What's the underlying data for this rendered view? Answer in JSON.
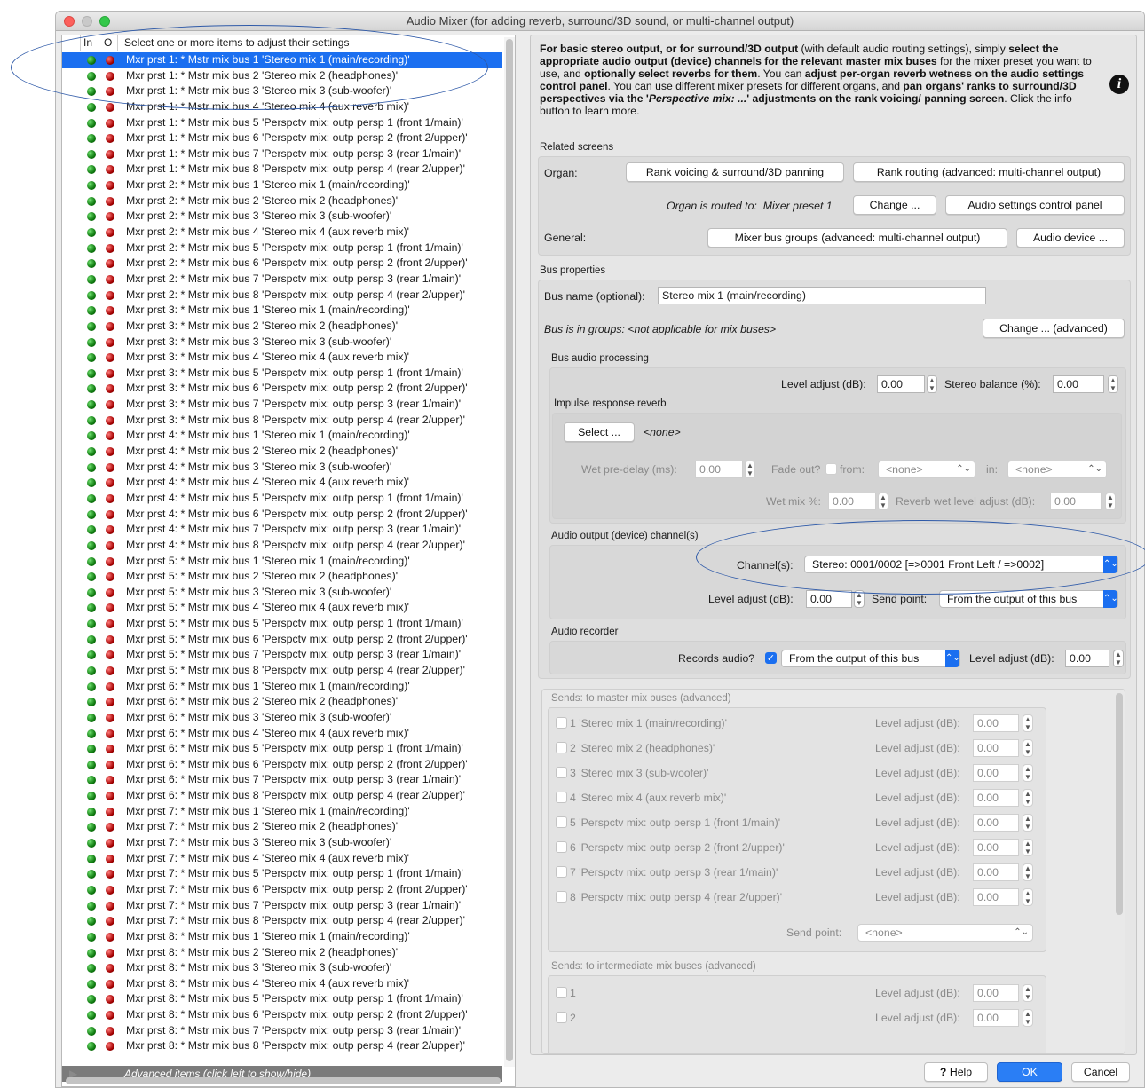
{
  "window": {
    "title": "Audio Mixer (for adding reverb, surround/3D sound, or multi-channel output)"
  },
  "list": {
    "col_in": "In",
    "col_out": "O",
    "col_desc": "Select one or more items to adjust their settings",
    "rows": [
      "Mxr prst 1: * Mstr mix bus 1 'Stereo mix 1 (main/recording)'",
      "Mxr prst 1: * Mstr mix bus 2 'Stereo mix 2 (headphones)'",
      "Mxr prst 1: * Mstr mix bus 3 'Stereo mix 3 (sub-woofer)'",
      "Mxr prst 1: * Mstr mix bus 4 'Stereo mix 4 (aux reverb mix)'",
      "Mxr prst 1: * Mstr mix bus 5 'Perspctv mix: outp persp 1 (front 1/main)'",
      "Mxr prst 1: * Mstr mix bus 6 'Perspctv mix: outp persp 2 (front 2/upper)'",
      "Mxr prst 1: * Mstr mix bus 7 'Perspctv mix: outp persp 3 (rear 1/main)'",
      "Mxr prst 1: * Mstr mix bus 8 'Perspctv mix: outp persp 4 (rear 2/upper)'",
      "Mxr prst 2: * Mstr mix bus 1 'Stereo mix 1 (main/recording)'",
      "Mxr prst 2: * Mstr mix bus 2 'Stereo mix 2 (headphones)'",
      "Mxr prst 2: * Mstr mix bus 3 'Stereo mix 3 (sub-woofer)'",
      "Mxr prst 2: * Mstr mix bus 4 'Stereo mix 4 (aux reverb mix)'",
      "Mxr prst 2: * Mstr mix bus 5 'Perspctv mix: outp persp 1 (front 1/main)'",
      "Mxr prst 2: * Mstr mix bus 6 'Perspctv mix: outp persp 2 (front 2/upper)'",
      "Mxr prst 2: * Mstr mix bus 7 'Perspctv mix: outp persp 3 (rear 1/main)'",
      "Mxr prst 2: * Mstr mix bus 8 'Perspctv mix: outp persp 4 (rear 2/upper)'",
      "Mxr prst 3: * Mstr mix bus 1 'Stereo mix 1 (main/recording)'",
      "Mxr prst 3: * Mstr mix bus 2 'Stereo mix 2 (headphones)'",
      "Mxr prst 3: * Mstr mix bus 3 'Stereo mix 3 (sub-woofer)'",
      "Mxr prst 3: * Mstr mix bus 4 'Stereo mix 4 (aux reverb mix)'",
      "Mxr prst 3: * Mstr mix bus 5 'Perspctv mix: outp persp 1 (front 1/main)'",
      "Mxr prst 3: * Mstr mix bus 6 'Perspctv mix: outp persp 2 (front 2/upper)'",
      "Mxr prst 3: * Mstr mix bus 7 'Perspctv mix: outp persp 3 (rear 1/main)'",
      "Mxr prst 3: * Mstr mix bus 8 'Perspctv mix: outp persp 4 (rear 2/upper)'",
      "Mxr prst 4: * Mstr mix bus 1 'Stereo mix 1 (main/recording)'",
      "Mxr prst 4: * Mstr mix bus 2 'Stereo mix 2 (headphones)'",
      "Mxr prst 4: * Mstr mix bus 3 'Stereo mix 3 (sub-woofer)'",
      "Mxr prst 4: * Mstr mix bus 4 'Stereo mix 4 (aux reverb mix)'",
      "Mxr prst 4: * Mstr mix bus 5 'Perspctv mix: outp persp 1 (front 1/main)'",
      "Mxr prst 4: * Mstr mix bus 6 'Perspctv mix: outp persp 2 (front 2/upper)'",
      "Mxr prst 4: * Mstr mix bus 7 'Perspctv mix: outp persp 3 (rear 1/main)'",
      "Mxr prst 4: * Mstr mix bus 8 'Perspctv mix: outp persp 4 (rear 2/upper)'",
      "Mxr prst 5: * Mstr mix bus 1 'Stereo mix 1 (main/recording)'",
      "Mxr prst 5: * Mstr mix bus 2 'Stereo mix 2 (headphones)'",
      "Mxr prst 5: * Mstr mix bus 3 'Stereo mix 3 (sub-woofer)'",
      "Mxr prst 5: * Mstr mix bus 4 'Stereo mix 4 (aux reverb mix)'",
      "Mxr prst 5: * Mstr mix bus 5 'Perspctv mix: outp persp 1 (front 1/main)'",
      "Mxr prst 5: * Mstr mix bus 6 'Perspctv mix: outp persp 2 (front 2/upper)'",
      "Mxr prst 5: * Mstr mix bus 7 'Perspctv mix: outp persp 3 (rear 1/main)'",
      "Mxr prst 5: * Mstr mix bus 8 'Perspctv mix: outp persp 4 (rear 2/upper)'",
      "Mxr prst 6: * Mstr mix bus 1 'Stereo mix 1 (main/recording)'",
      "Mxr prst 6: * Mstr mix bus 2 'Stereo mix 2 (headphones)'",
      "Mxr prst 6: * Mstr mix bus 3 'Stereo mix 3 (sub-woofer)'",
      "Mxr prst 6: * Mstr mix bus 4 'Stereo mix 4 (aux reverb mix)'",
      "Mxr prst 6: * Mstr mix bus 5 'Perspctv mix: outp persp 1 (front 1/main)'",
      "Mxr prst 6: * Mstr mix bus 6 'Perspctv mix: outp persp 2 (front 2/upper)'",
      "Mxr prst 6: * Mstr mix bus 7 'Perspctv mix: outp persp 3 (rear 1/main)'",
      "Mxr prst 6: * Mstr mix bus 8 'Perspctv mix: outp persp 4 (rear 2/upper)'",
      "Mxr prst 7: * Mstr mix bus 1 'Stereo mix 1 (main/recording)'",
      "Mxr prst 7: * Mstr mix bus 2 'Stereo mix 2 (headphones)'",
      "Mxr prst 7: * Mstr mix bus 3 'Stereo mix 3 (sub-woofer)'",
      "Mxr prst 7: * Mstr mix bus 4 'Stereo mix 4 (aux reverb mix)'",
      "Mxr prst 7: * Mstr mix bus 5 'Perspctv mix: outp persp 1 (front 1/main)'",
      "Mxr prst 7: * Mstr mix bus 6 'Perspctv mix: outp persp 2 (front 2/upper)'",
      "Mxr prst 7: * Mstr mix bus 7 'Perspctv mix: outp persp 3 (rear 1/main)'",
      "Mxr prst 7: * Mstr mix bus 8 'Perspctv mix: outp persp 4 (rear 2/upper)'",
      "Mxr prst 8: * Mstr mix bus 1 'Stereo mix 1 (main/recording)'",
      "Mxr prst 8: * Mstr mix bus 2 'Stereo mix 2 (headphones)'",
      "Mxr prst 8: * Mstr mix bus 3 'Stereo mix 3 (sub-woofer)'",
      "Mxr prst 8: * Mstr mix bus 4 'Stereo mix 4 (aux reverb mix)'",
      "Mxr prst 8: * Mstr mix bus 5 'Perspctv mix: outp persp 1 (front 1/main)'",
      "Mxr prst 8: * Mstr mix bus 6 'Perspctv mix: outp persp 2 (front 2/upper)'",
      "Mxr prst 8: * Mstr mix bus 7 'Perspctv mix: outp persp 3 (rear 1/main)'",
      "Mxr prst 8: * Mstr mix bus 8 'Perspctv mix: outp persp 4 (rear 2/upper)'"
    ],
    "selected_index": 0,
    "advanced_label": "Advanced items (click left to show/hide)"
  },
  "info": {
    "p1": "For basic stereo output, or for surround/3D output",
    "p2": " (with default audio routing settings), simply ",
    "p3": "select the appropriate audio output (device) channels for the relevant master mix buses",
    "p4": " for the mixer preset you want to use, and ",
    "p5": "optionally select reverbs for them",
    "p6": ". You can ",
    "p7": "adjust per-organ reverb wetness on the audio settings control panel",
    "p8": ". You can use different mixer presets for different organs, and ",
    "p9": "pan organs' ranks to surround/3D perspectives via the '",
    "p10": "Perspective mix: ...",
    "p11": "' adjustments on the rank voicing/ panning screen",
    "p12": ". Click the info button to learn more."
  },
  "related": {
    "title": "Related screens",
    "organ_label": "Organ:",
    "rank_voicing_btn": "Rank voicing & surround/3D panning",
    "rank_routing_btn": "Rank routing (advanced: multi-channel output)",
    "routed_label": "Organ is routed to:",
    "routed_value": "Mixer preset 1",
    "change_btn": "Change ...",
    "audio_settings_btn": "Audio settings control panel",
    "general_label": "General:",
    "mixer_groups_btn": "Mixer bus groups (advanced: multi-channel output)",
    "audio_device_btn": "Audio device ..."
  },
  "bus": {
    "title": "Bus properties",
    "name_label": "Bus name (optional):",
    "name_value": "Stereo mix 1 (main/recording)",
    "groups_label": "Bus is in groups: <not applicable for mix buses>",
    "change_adv_btn": "Change ... (advanced)"
  },
  "processing": {
    "title": "Bus audio processing",
    "level_label": "Level adjust (dB):",
    "level_value": "0.00",
    "balance_label": "Stereo balance (%):",
    "balance_value": "0.00",
    "ir_title": "Impulse response reverb",
    "select_btn": "Select ...",
    "ir_value": "<none>",
    "predelay_label": "Wet pre-delay (ms):",
    "predelay_value": "0.00",
    "fadeout_label": "Fade out?",
    "from_label": "from:",
    "from_value": "<none>",
    "in_label": "in:",
    "in_value": "<none>",
    "wetmix_label": "Wet mix %:",
    "wetmix_value": "0.00",
    "reverb_wet_label": "Reverb wet level adjust (dB):",
    "reverb_wet_value": "0.00"
  },
  "output": {
    "title": "Audio output (device) channel(s)",
    "channels_label": "Channel(s):",
    "channels_value": "Stereo: 0001/0002 [=>0001 Front Left / =>0002]",
    "level_label": "Level adjust (dB):",
    "level_value": "0.00",
    "sendpoint_label": "Send point:",
    "sendpoint_value": "From the output of this bus"
  },
  "recorder": {
    "title": "Audio recorder",
    "records_label": "Records audio?",
    "records_value": "From the output of this bus",
    "level_label": "Level adjust (dB):",
    "level_value": "0.00"
  },
  "sends_master": {
    "title": "Sends: to master mix buses (advanced)",
    "level_label": "Level adjust (dB):",
    "items": [
      {
        "label": "1 'Stereo mix 1 (main/recording)'",
        "value": "0.00"
      },
      {
        "label": "2 'Stereo mix 2 (headphones)'",
        "value": "0.00"
      },
      {
        "label": "3 'Stereo mix 3 (sub-woofer)'",
        "value": "0.00"
      },
      {
        "label": "4 'Stereo mix 4 (aux reverb mix)'",
        "value": "0.00"
      },
      {
        "label": "5 'Perspctv mix: outp persp 1 (front 1/main)'",
        "value": "0.00"
      },
      {
        "label": "6 'Perspctv mix: outp persp 2 (front 2/upper)'",
        "value": "0.00"
      },
      {
        "label": "7 'Perspctv mix: outp persp 3 (rear 1/main)'",
        "value": "0.00"
      },
      {
        "label": "8 'Perspctv mix: outp persp 4 (rear 2/upper)'",
        "value": "0.00"
      }
    ],
    "sendpoint_label": "Send point:",
    "sendpoint_value": "<none>"
  },
  "sends_inter": {
    "title": "Sends: to intermediate mix buses (advanced)",
    "level_label": "Level adjust (dB):",
    "items": [
      {
        "label": "1",
        "value": "0.00"
      },
      {
        "label": "2",
        "value": "0.00"
      }
    ]
  },
  "footer": {
    "help_btn": "Help",
    "ok_btn": "OK",
    "cancel_btn": "Cancel"
  },
  "colors": {
    "accent": "#1b6ff0",
    "annotation": "#2f5aa8"
  }
}
